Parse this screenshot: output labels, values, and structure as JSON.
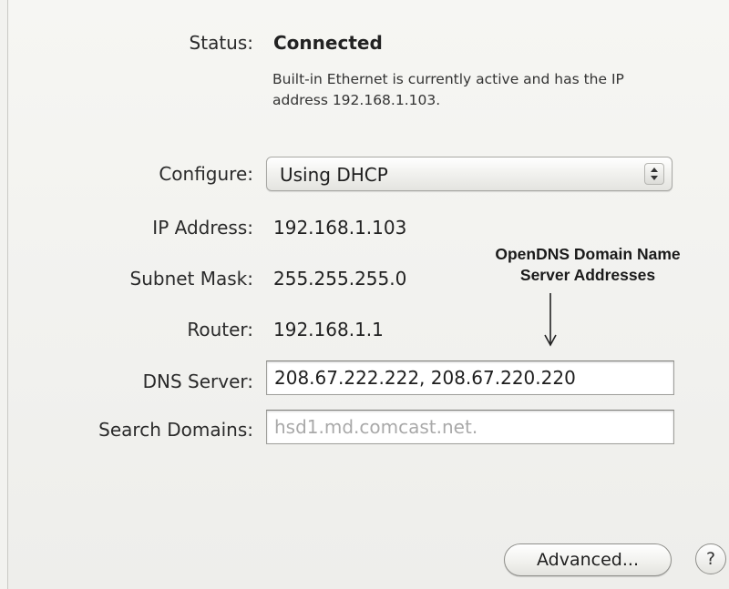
{
  "status": {
    "label": "Status:",
    "value": "Connected",
    "description": "Built-in Ethernet is currently active and has the IP address 192.168.1.103."
  },
  "configure": {
    "label": "Configure:",
    "value": "Using DHCP"
  },
  "ip_address": {
    "label": "IP Address:",
    "value": "192.168.1.103"
  },
  "subnet_mask": {
    "label": "Subnet Mask:",
    "value": "255.255.255.0"
  },
  "router": {
    "label": "Router:",
    "value": "192.168.1.1"
  },
  "dns_server": {
    "label": "DNS Server:",
    "value": "208.67.222.222, 208.67.220.220"
  },
  "search_domains": {
    "label": "Search Domains:",
    "placeholder": "hsd1.md.comcast.net."
  },
  "annotation": {
    "line1": "OpenDNS Domain Name",
    "line2": "Server Addresses"
  },
  "buttons": {
    "advanced": "Advanced...",
    "help": "?"
  }
}
